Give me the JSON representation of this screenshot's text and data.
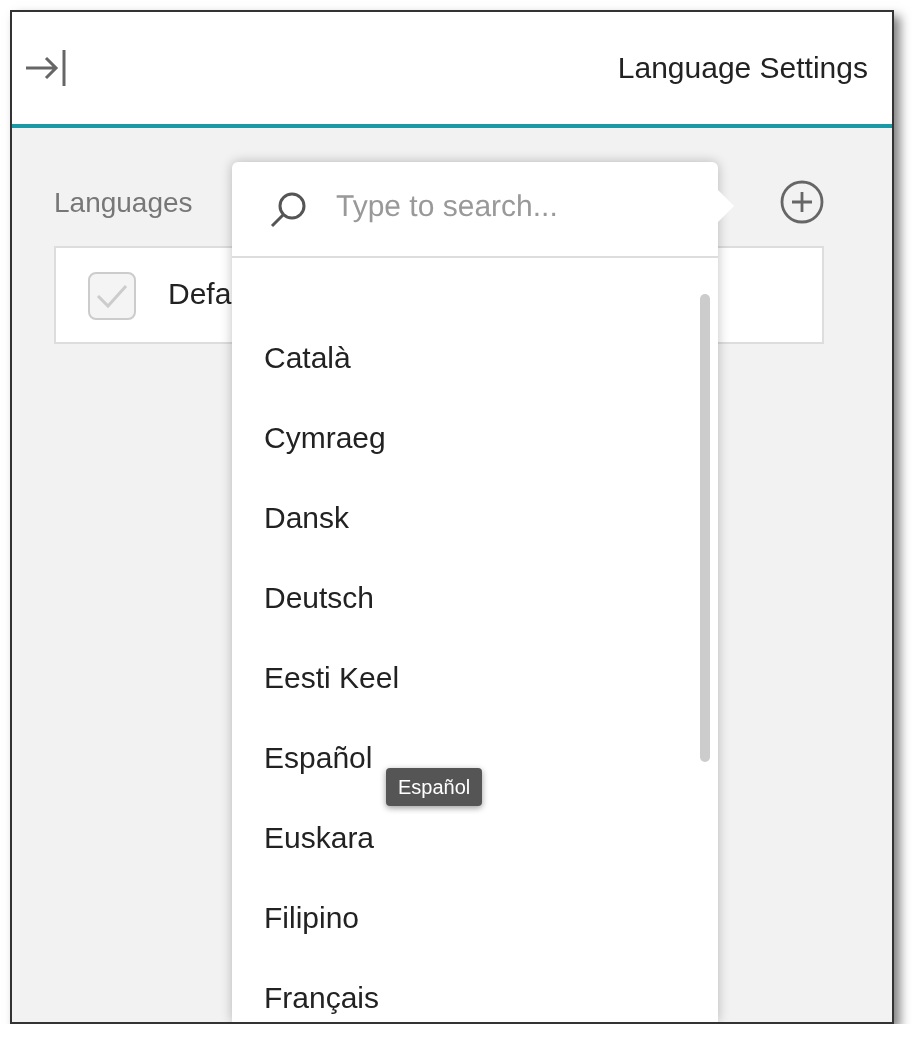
{
  "header": {
    "title": "Language Settings"
  },
  "section": {
    "label": "Languages"
  },
  "languages": [
    {
      "name": "Defa",
      "checked": true,
      "disabled": true
    }
  ],
  "dropdown": {
    "placeholder": "Type to search...",
    "options": [
      {
        "label": "Català"
      },
      {
        "label": "Cymraeg"
      },
      {
        "label": "Dansk"
      },
      {
        "label": "Deutsch"
      },
      {
        "label": "Eesti Keel"
      },
      {
        "label": "Español"
      },
      {
        "label": "Euskara"
      },
      {
        "label": "Filipino"
      },
      {
        "label": "Français"
      }
    ]
  },
  "tooltip": {
    "text": "Español"
  }
}
